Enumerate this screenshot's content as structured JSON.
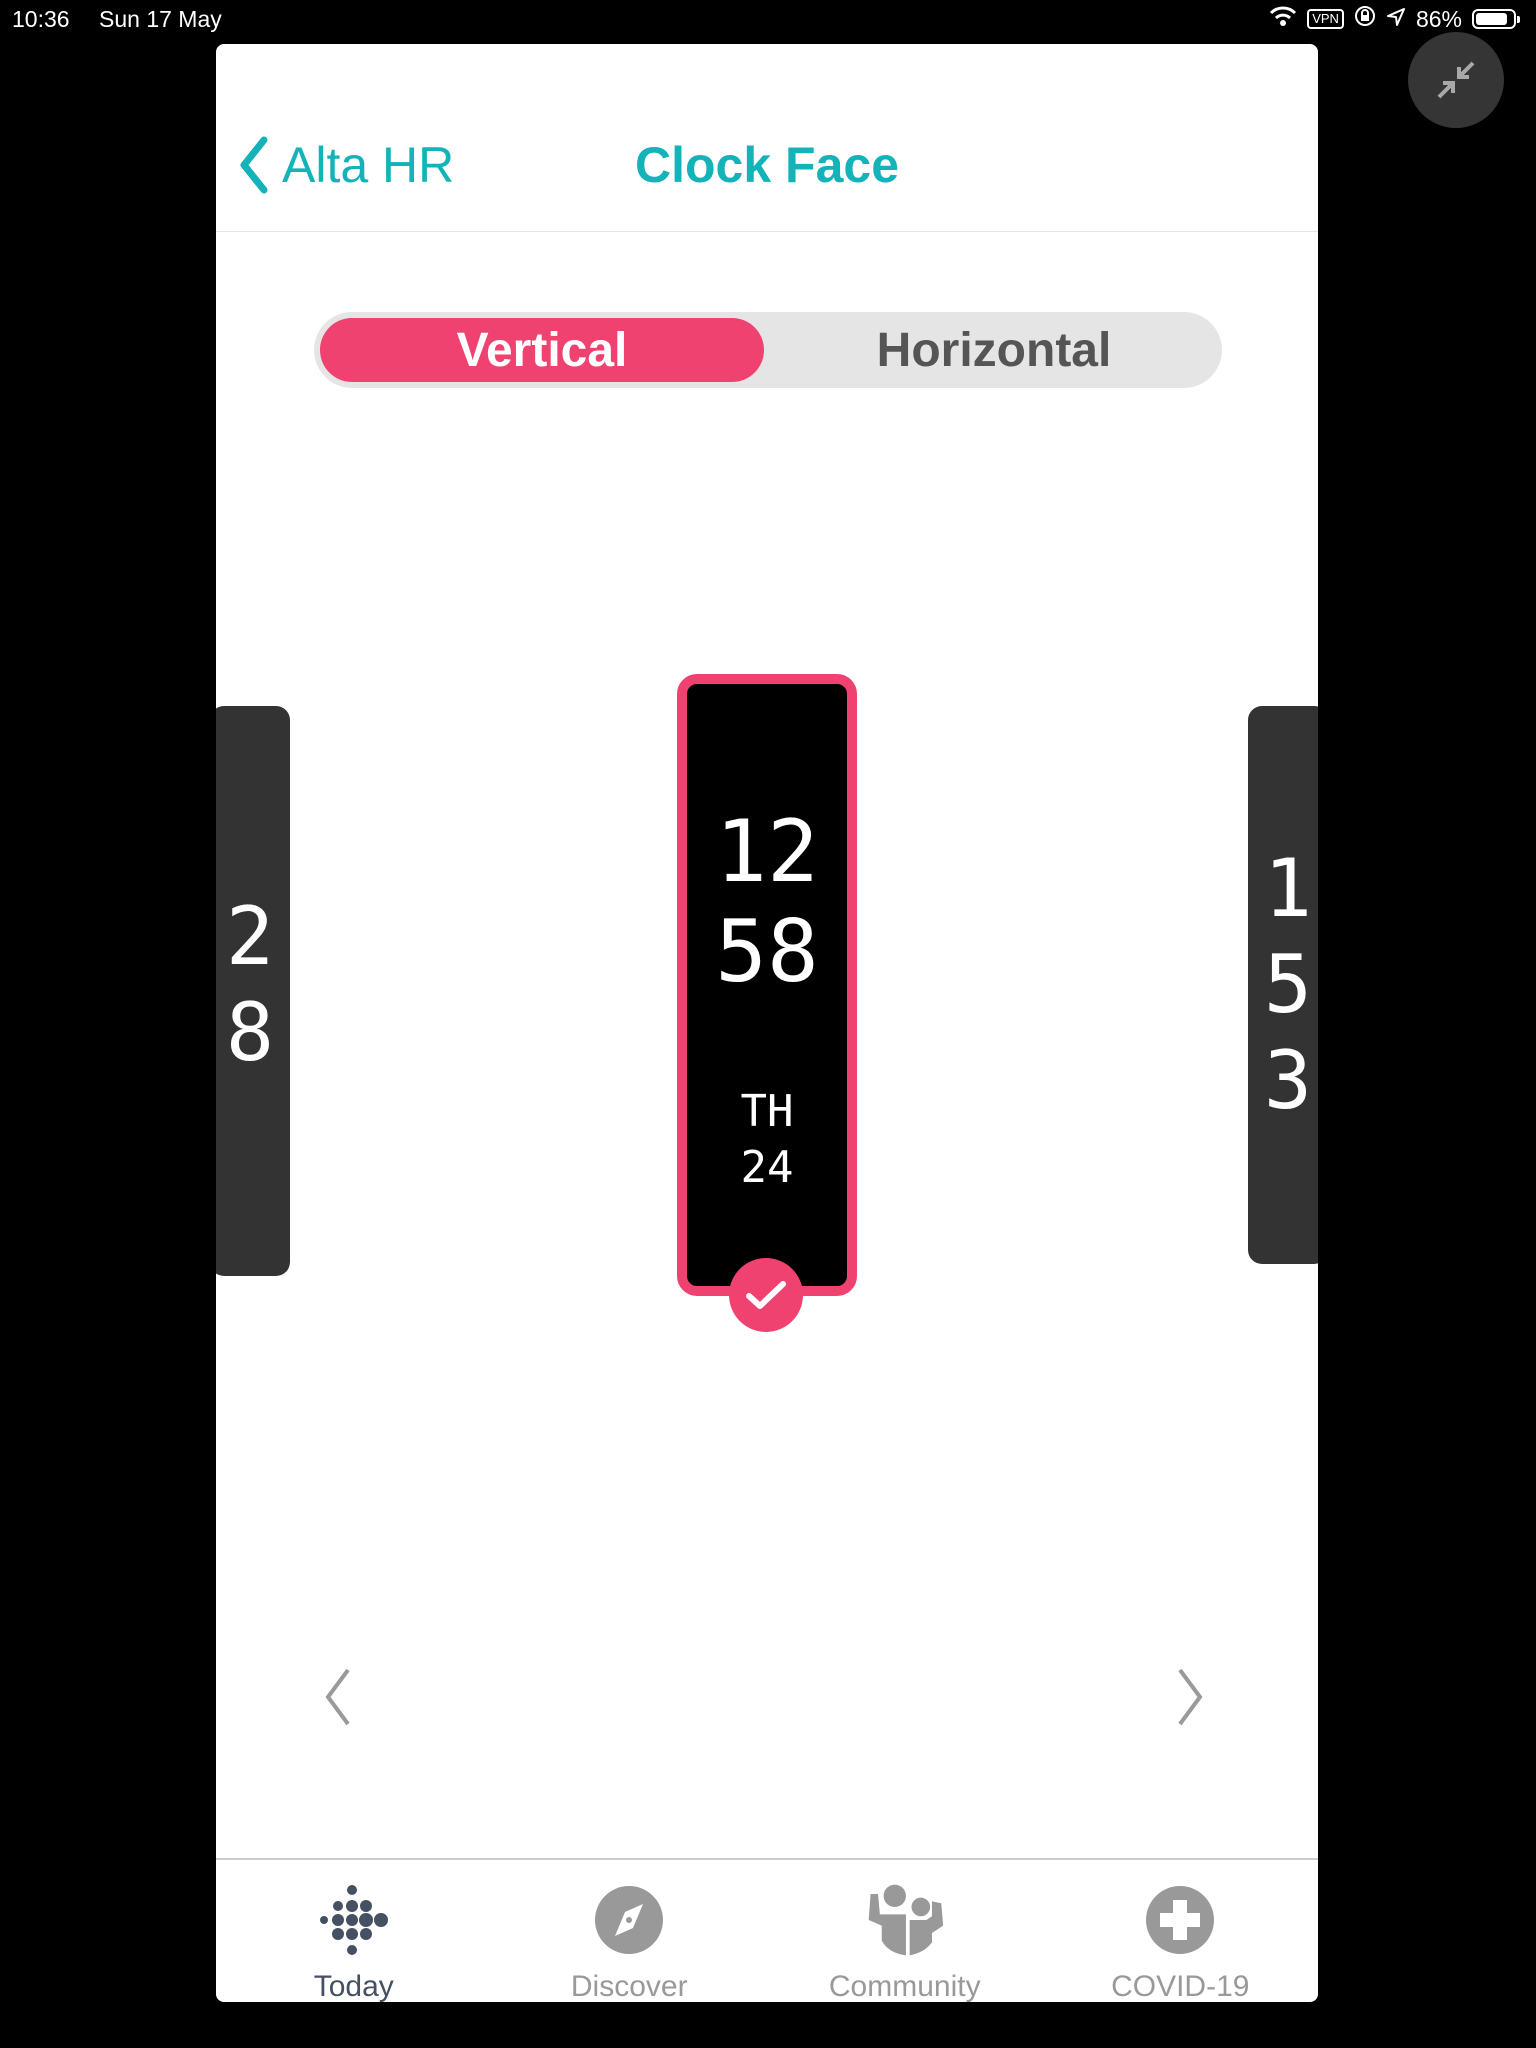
{
  "status_bar": {
    "time": "10:36",
    "date": "Sun 17 May",
    "vpn": "VPN",
    "battery": "86%",
    "battery_level": 0.86
  },
  "nav": {
    "back_label": "Alta HR",
    "title": "Clock Face"
  },
  "orientation": {
    "options": [
      "Vertical",
      "Horizontal"
    ],
    "selected": "Vertical"
  },
  "clock_faces": {
    "previous": {
      "lines": [
        "2",
        "8"
      ]
    },
    "current": {
      "hour": "12",
      "minute": "58",
      "day": "TH",
      "date": "24",
      "selected": true
    },
    "next": {
      "lines": [
        "1",
        "5",
        "3"
      ]
    }
  },
  "tabs": [
    {
      "label": "Today",
      "icon": "fitbit-dots-icon",
      "active": true
    },
    {
      "label": "Discover",
      "icon": "compass-icon",
      "active": false
    },
    {
      "label": "Community",
      "icon": "community-icon",
      "active": false
    },
    {
      "label": "COVID-19",
      "icon": "medical-cross-icon",
      "active": false
    }
  ],
  "colors": {
    "accent": "#14b3b9",
    "selected": "#ef4270",
    "tab_active": "#455063",
    "tab_inactive": "#999999"
  }
}
